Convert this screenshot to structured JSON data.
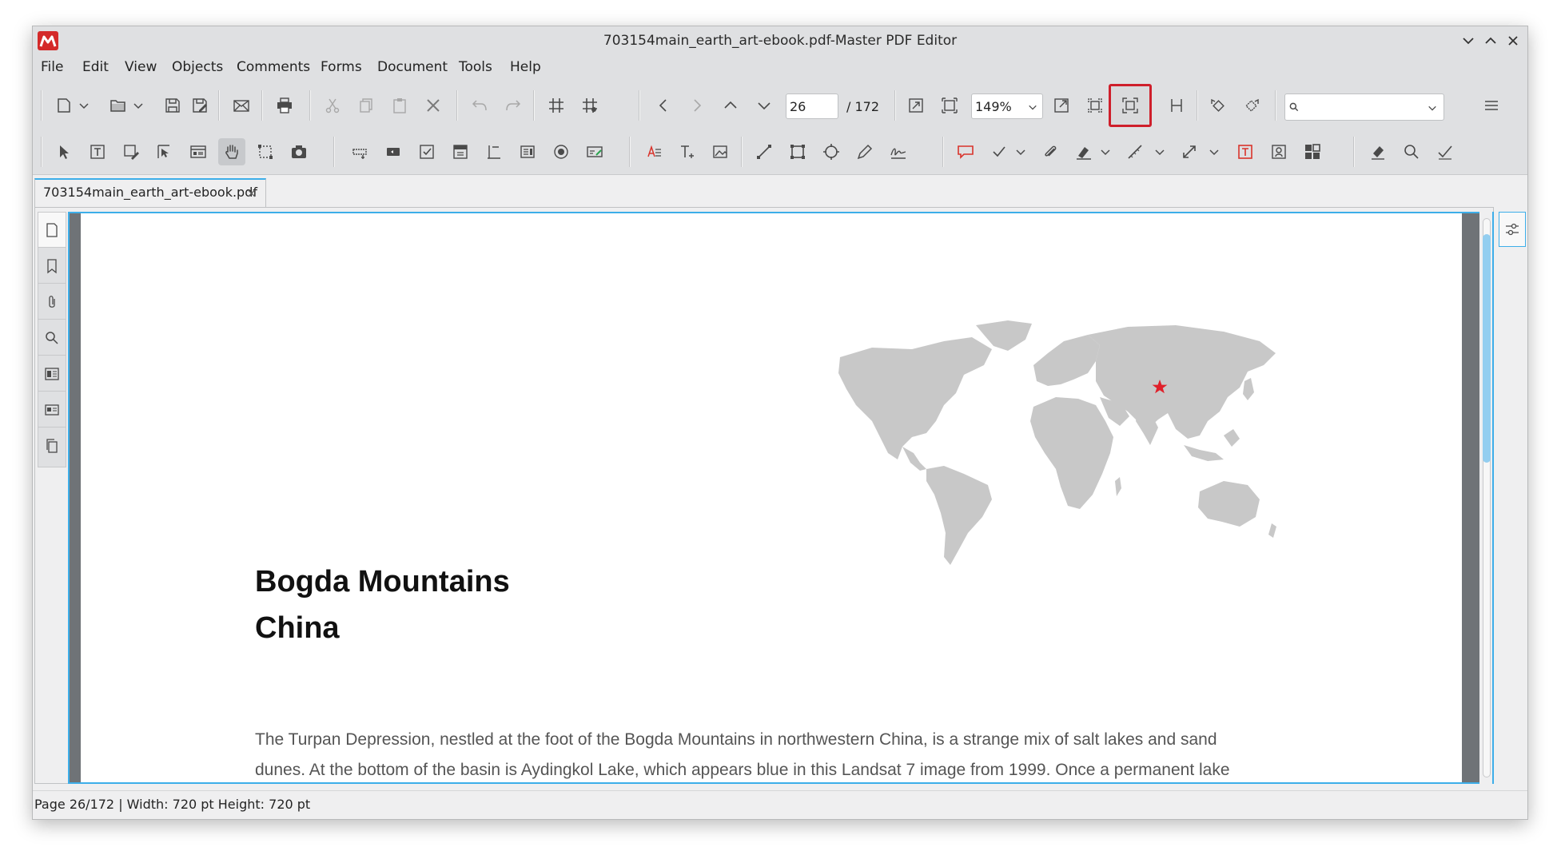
{
  "window": {
    "title": "703154main_earth_art-ebook.pdf-Master PDF Editor"
  },
  "menu": {
    "items": [
      "File",
      "Edit",
      "View",
      "Objects",
      "Comments",
      "Forms",
      "Document",
      "Tools",
      "Help"
    ]
  },
  "toolbar": {
    "page_number": "26",
    "page_total": "/ 172",
    "zoom": "149%",
    "search_placeholder": ""
  },
  "tab": {
    "label": "703154main_earth_art-ebook.pdf",
    "close": "×"
  },
  "page": {
    "heading_line1": "Bogda Mountains",
    "heading_line2": "China",
    "body_line1": "The Turpan Depression, nestled at the foot of the Bogda Mountains in northwestern China, is a strange mix of salt lakes and sand",
    "body_line2": "dunes. At the bottom of the basin is Aydingkol Lake, which appears blue in this Landsat 7 image from 1999. Once a permanent lake"
  },
  "status": {
    "text": "Page 26/172 | Width: 720 pt Height: 720 pt"
  },
  "colors": {
    "accent": "#3daee9",
    "highlight": "#cf1f2b",
    "map": "#c8c8c8",
    "marker": "#e0202a"
  }
}
